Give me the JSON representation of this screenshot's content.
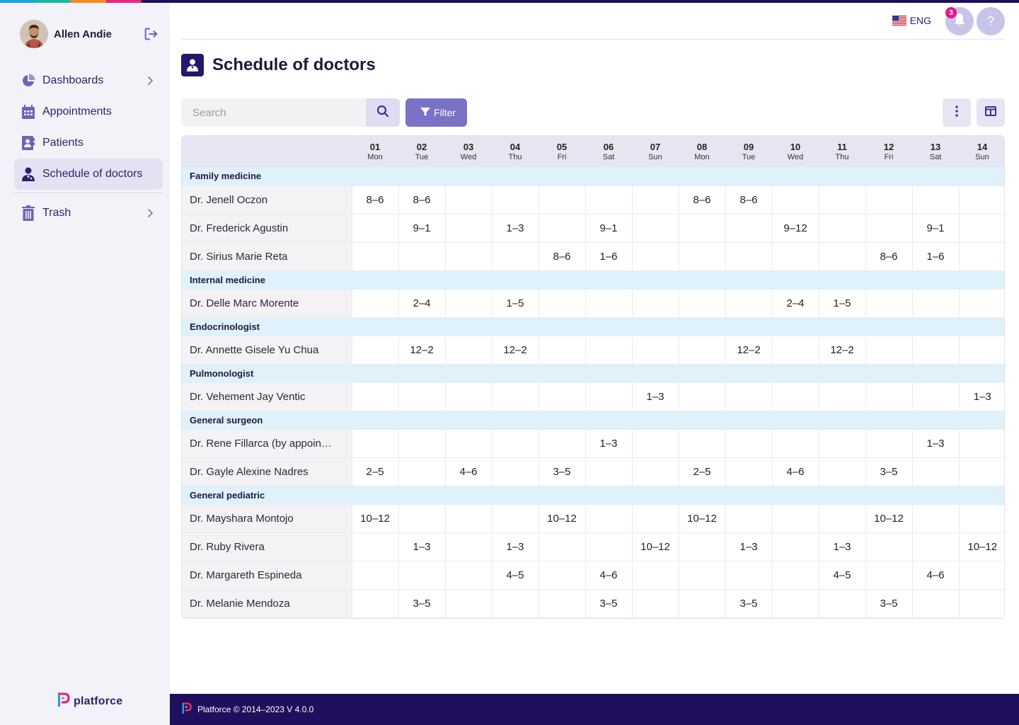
{
  "colors": {
    "topstrip": [
      "#1aa3e0",
      "#19b8a0",
      "#f7891f",
      "#e8247f",
      "#1d0f5a"
    ],
    "sidebar_bg": "#f3f2f8",
    "accent": "#7a72c6",
    "footer_bg": "#1f0f5c",
    "section_bg": "#dff1fb",
    "badge": "#e3178c"
  },
  "user": {
    "name": "Allen Andie"
  },
  "sidebar": {
    "items": [
      {
        "label": "Dashboards",
        "icon": "pie-chart-icon",
        "chevron": true,
        "active": false
      },
      {
        "label": "Appointments",
        "icon": "calendar-icon",
        "chevron": false,
        "active": false
      },
      {
        "label": "Patients",
        "icon": "contact-card-icon",
        "chevron": false,
        "active": false
      },
      {
        "label": "Schedule of doctors",
        "icon": "doctor-icon",
        "chevron": false,
        "active": true
      },
      {
        "label": "Trash",
        "icon": "trash-icon",
        "chevron": true,
        "active": false
      }
    ],
    "brand": "platforce"
  },
  "topbar": {
    "language": "ENG",
    "notification_count": "3",
    "help_label": "?"
  },
  "page": {
    "title": "Schedule of doctors"
  },
  "toolbar": {
    "search_placeholder": "Search",
    "filter_label": "Filter"
  },
  "schedule": {
    "days": [
      {
        "num": "01",
        "name": "Mon"
      },
      {
        "num": "02",
        "name": "Tue"
      },
      {
        "num": "03",
        "name": "Wed"
      },
      {
        "num": "04",
        "name": "Thu"
      },
      {
        "num": "05",
        "name": "Fri"
      },
      {
        "num": "06",
        "name": "Sat"
      },
      {
        "num": "07",
        "name": "Sun"
      },
      {
        "num": "08",
        "name": "Mon"
      },
      {
        "num": "09",
        "name": "Tue"
      },
      {
        "num": "10",
        "name": "Wed"
      },
      {
        "num": "11",
        "name": "Thu"
      },
      {
        "num": "12",
        "name": "Fri"
      },
      {
        "num": "13",
        "name": "Sat"
      },
      {
        "num": "14",
        "name": "Sun"
      }
    ],
    "sections": [
      {
        "name": "Family medicine",
        "doctors": [
          {
            "name": "Dr. Jenell Oczon",
            "hours": [
              "8–6",
              "8–6",
              "",
              "",
              "",
              "",
              "",
              "8–6",
              "8–6",
              "",
              "",
              "",
              "",
              ""
            ]
          },
          {
            "name": "Dr. Frederick Agustin",
            "hours": [
              "",
              "9–1",
              "",
              "1–3",
              "",
              "9–1",
              "",
              "",
              "",
              "9–12",
              "",
              "",
              "9–1",
              ""
            ]
          },
          {
            "name": "Dr. Sirius Marie Reta",
            "hours": [
              "",
              "",
              "",
              "",
              "8–6",
              "1–6",
              "",
              "",
              "",
              "",
              "",
              "8–6",
              "1–6",
              ""
            ]
          }
        ]
      },
      {
        "name": "Internal medicine",
        "doctors": [
          {
            "name": "Dr. Delle Marc Morente",
            "hours": [
              "",
              "2–4",
              "",
              "1–5",
              "",
              "",
              "",
              "",
              "",
              "2–4",
              "1–5",
              "",
              "",
              ""
            ]
          }
        ]
      },
      {
        "name": "Endocrinologist",
        "doctors": [
          {
            "name": "Dr. Annette Gisele Yu Chua",
            "hours": [
              "",
              "12–2",
              "",
              "12–2",
              "",
              "",
              "",
              "",
              "12–2",
              "",
              "12–2",
              "",
              "",
              ""
            ]
          }
        ]
      },
      {
        "name": "Pulmonologist",
        "doctors": [
          {
            "name": "Dr. Vehement Jay Ventic",
            "hours": [
              "",
              "",
              "",
              "",
              "",
              "",
              "1–3",
              "",
              "",
              "",
              "",
              "",
              "",
              "1–3"
            ]
          }
        ]
      },
      {
        "name": "General surgeon",
        "doctors": [
          {
            "name": "Dr. Rene Fillarca (by appoin…",
            "hours": [
              "",
              "",
              "",
              "",
              "",
              "1–3",
              "",
              "",
              "",
              "",
              "",
              "",
              "1–3",
              ""
            ]
          },
          {
            "name": "Dr. Gayle Alexine Nadres",
            "hours": [
              "2–5",
              "",
              "4–6",
              "",
              "3–5",
              "",
              "",
              "2–5",
              "",
              "4–6",
              "",
              "3–5",
              "",
              ""
            ]
          }
        ]
      },
      {
        "name": "General pediatric",
        "doctors": [
          {
            "name": "Dr. Mayshara Montojo",
            "hours": [
              "10–12",
              "",
              "",
              "",
              "10–12",
              "",
              "",
              "10–12",
              "",
              "",
              "",
              "10–12",
              "",
              ""
            ]
          },
          {
            "name": "Dr. Ruby Rivera",
            "hours": [
              "",
              "1–3",
              "",
              "1–3",
              "",
              "",
              "10–12",
              "",
              "1–3",
              "",
              "1–3",
              "",
              "",
              "10–12"
            ]
          },
          {
            "name": "Dr. Margareth Espineda",
            "hours": [
              "",
              "",
              "",
              "4–5",
              "",
              "4–6",
              "",
              "",
              "",
              "",
              "4–5",
              "",
              "4–6",
              ""
            ]
          },
          {
            "name": "Dr. Melanie Mendoza",
            "hours": [
              "",
              "3–5",
              "",
              "",
              "",
              "3–5",
              "",
              "",
              "3–5",
              "",
              "",
              "3–5",
              "",
              ""
            ]
          }
        ]
      }
    ]
  },
  "footer": {
    "text": "Platforce © 2014–2023 V 4.0.0"
  }
}
